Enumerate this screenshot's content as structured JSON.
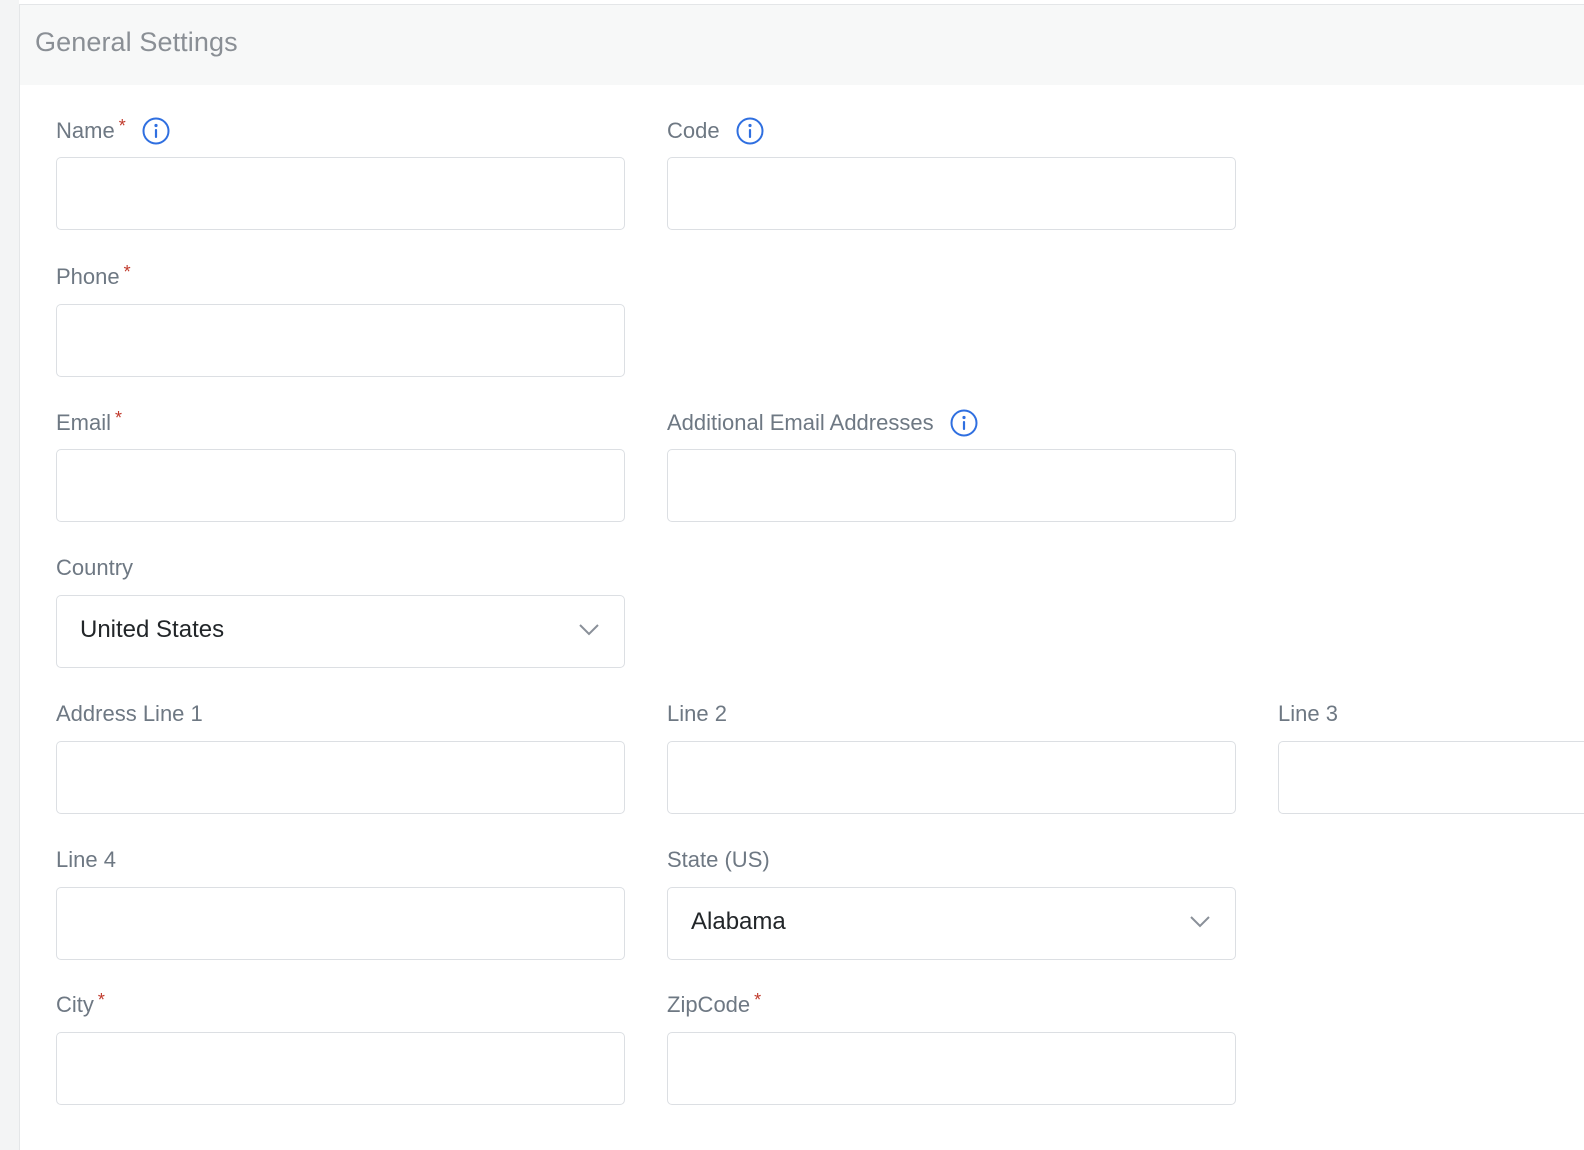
{
  "section": {
    "title": "General Settings"
  },
  "fields": {
    "name": {
      "label": "Name",
      "required_mark": "*",
      "value": ""
    },
    "code": {
      "label": "Code",
      "value": ""
    },
    "phone": {
      "label": "Phone",
      "required_mark": "*",
      "value": ""
    },
    "email": {
      "label": "Email",
      "required_mark": "*",
      "value": ""
    },
    "additional_emails": {
      "label": "Additional Email Addresses",
      "value": ""
    },
    "country": {
      "label": "Country",
      "selected": "United States"
    },
    "address_line_1": {
      "label": "Address Line 1",
      "value": ""
    },
    "line_2": {
      "label": "Line 2",
      "value": ""
    },
    "line_3": {
      "label": "Line 3",
      "value": ""
    },
    "line_4": {
      "label": "Line 4",
      "value": ""
    },
    "state": {
      "label": "State (US)",
      "selected": "Alabama"
    },
    "city": {
      "label": "City",
      "required_mark": "*",
      "value": ""
    },
    "zipcode": {
      "label": "ZipCode",
      "required_mark": "*",
      "value": ""
    }
  },
  "icons": {
    "info": "info-circle-icon",
    "dropdown": "chevron-down-icon"
  },
  "colors": {
    "info_icon": "#2f6fe0",
    "required": "#c0392b",
    "label": "#6e7883",
    "border": "#dcdfe3"
  }
}
